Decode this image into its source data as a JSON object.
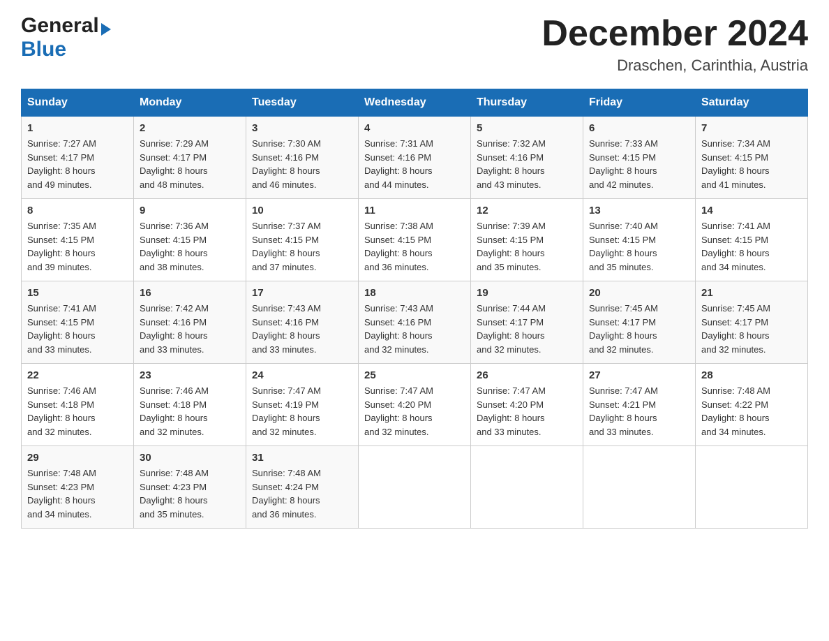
{
  "header": {
    "logo_general": "General",
    "logo_blue": "Blue",
    "month_title": "December 2024",
    "location": "Draschen, Carinthia, Austria"
  },
  "days_of_week": [
    "Sunday",
    "Monday",
    "Tuesday",
    "Wednesday",
    "Thursday",
    "Friday",
    "Saturday"
  ],
  "weeks": [
    [
      {
        "day": "1",
        "sunrise": "7:27 AM",
        "sunset": "4:17 PM",
        "daylight": "8 hours and 49 minutes."
      },
      {
        "day": "2",
        "sunrise": "7:29 AM",
        "sunset": "4:17 PM",
        "daylight": "8 hours and 48 minutes."
      },
      {
        "day": "3",
        "sunrise": "7:30 AM",
        "sunset": "4:16 PM",
        "daylight": "8 hours and 46 minutes."
      },
      {
        "day": "4",
        "sunrise": "7:31 AM",
        "sunset": "4:16 PM",
        "daylight": "8 hours and 44 minutes."
      },
      {
        "day": "5",
        "sunrise": "7:32 AM",
        "sunset": "4:16 PM",
        "daylight": "8 hours and 43 minutes."
      },
      {
        "day": "6",
        "sunrise": "7:33 AM",
        "sunset": "4:15 PM",
        "daylight": "8 hours and 42 minutes."
      },
      {
        "day": "7",
        "sunrise": "7:34 AM",
        "sunset": "4:15 PM",
        "daylight": "8 hours and 41 minutes."
      }
    ],
    [
      {
        "day": "8",
        "sunrise": "7:35 AM",
        "sunset": "4:15 PM",
        "daylight": "8 hours and 39 minutes."
      },
      {
        "day": "9",
        "sunrise": "7:36 AM",
        "sunset": "4:15 PM",
        "daylight": "8 hours and 38 minutes."
      },
      {
        "day": "10",
        "sunrise": "7:37 AM",
        "sunset": "4:15 PM",
        "daylight": "8 hours and 37 minutes."
      },
      {
        "day": "11",
        "sunrise": "7:38 AM",
        "sunset": "4:15 PM",
        "daylight": "8 hours and 36 minutes."
      },
      {
        "day": "12",
        "sunrise": "7:39 AM",
        "sunset": "4:15 PM",
        "daylight": "8 hours and 35 minutes."
      },
      {
        "day": "13",
        "sunrise": "7:40 AM",
        "sunset": "4:15 PM",
        "daylight": "8 hours and 35 minutes."
      },
      {
        "day": "14",
        "sunrise": "7:41 AM",
        "sunset": "4:15 PM",
        "daylight": "8 hours and 34 minutes."
      }
    ],
    [
      {
        "day": "15",
        "sunrise": "7:41 AM",
        "sunset": "4:15 PM",
        "daylight": "8 hours and 33 minutes."
      },
      {
        "day": "16",
        "sunrise": "7:42 AM",
        "sunset": "4:16 PM",
        "daylight": "8 hours and 33 minutes."
      },
      {
        "day": "17",
        "sunrise": "7:43 AM",
        "sunset": "4:16 PM",
        "daylight": "8 hours and 33 minutes."
      },
      {
        "day": "18",
        "sunrise": "7:43 AM",
        "sunset": "4:16 PM",
        "daylight": "8 hours and 32 minutes."
      },
      {
        "day": "19",
        "sunrise": "7:44 AM",
        "sunset": "4:17 PM",
        "daylight": "8 hours and 32 minutes."
      },
      {
        "day": "20",
        "sunrise": "7:45 AM",
        "sunset": "4:17 PM",
        "daylight": "8 hours and 32 minutes."
      },
      {
        "day": "21",
        "sunrise": "7:45 AM",
        "sunset": "4:17 PM",
        "daylight": "8 hours and 32 minutes."
      }
    ],
    [
      {
        "day": "22",
        "sunrise": "7:46 AM",
        "sunset": "4:18 PM",
        "daylight": "8 hours and 32 minutes."
      },
      {
        "day": "23",
        "sunrise": "7:46 AM",
        "sunset": "4:18 PM",
        "daylight": "8 hours and 32 minutes."
      },
      {
        "day": "24",
        "sunrise": "7:47 AM",
        "sunset": "4:19 PM",
        "daylight": "8 hours and 32 minutes."
      },
      {
        "day": "25",
        "sunrise": "7:47 AM",
        "sunset": "4:20 PM",
        "daylight": "8 hours and 32 minutes."
      },
      {
        "day": "26",
        "sunrise": "7:47 AM",
        "sunset": "4:20 PM",
        "daylight": "8 hours and 33 minutes."
      },
      {
        "day": "27",
        "sunrise": "7:47 AM",
        "sunset": "4:21 PM",
        "daylight": "8 hours and 33 minutes."
      },
      {
        "day": "28",
        "sunrise": "7:48 AM",
        "sunset": "4:22 PM",
        "daylight": "8 hours and 34 minutes."
      }
    ],
    [
      {
        "day": "29",
        "sunrise": "7:48 AM",
        "sunset": "4:23 PM",
        "daylight": "8 hours and 34 minutes."
      },
      {
        "day": "30",
        "sunrise": "7:48 AM",
        "sunset": "4:23 PM",
        "daylight": "8 hours and 35 minutes."
      },
      {
        "day": "31",
        "sunrise": "7:48 AM",
        "sunset": "4:24 PM",
        "daylight": "8 hours and 36 minutes."
      },
      null,
      null,
      null,
      null
    ]
  ],
  "labels": {
    "sunrise": "Sunrise:",
    "sunset": "Sunset:",
    "daylight": "Daylight:"
  }
}
